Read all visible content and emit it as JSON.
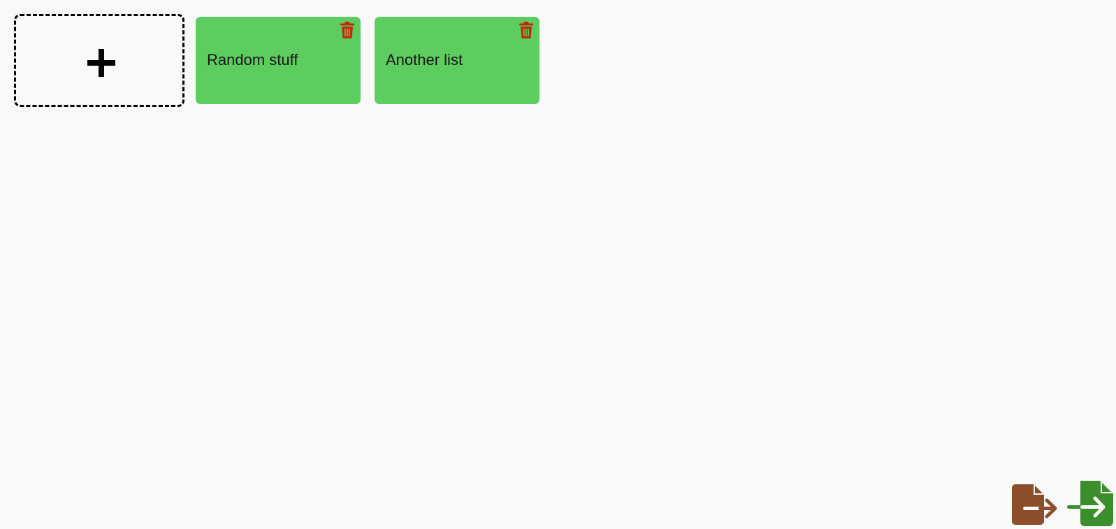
{
  "add_card": {
    "icon": "plus-icon"
  },
  "lists": [
    {
      "title": "Random stuff",
      "delete_icon": "trash-icon"
    },
    {
      "title": "Another list",
      "delete_icon": "trash-icon"
    }
  ],
  "footer": {
    "export_icon": "file-export-icon",
    "import_icon": "file-import-icon"
  },
  "colors": {
    "background": "#f9f9f9",
    "card": "#5ecd60",
    "trash": "#c02a0a",
    "export": "#8c4d2b",
    "import": "#3b8e2b"
  }
}
